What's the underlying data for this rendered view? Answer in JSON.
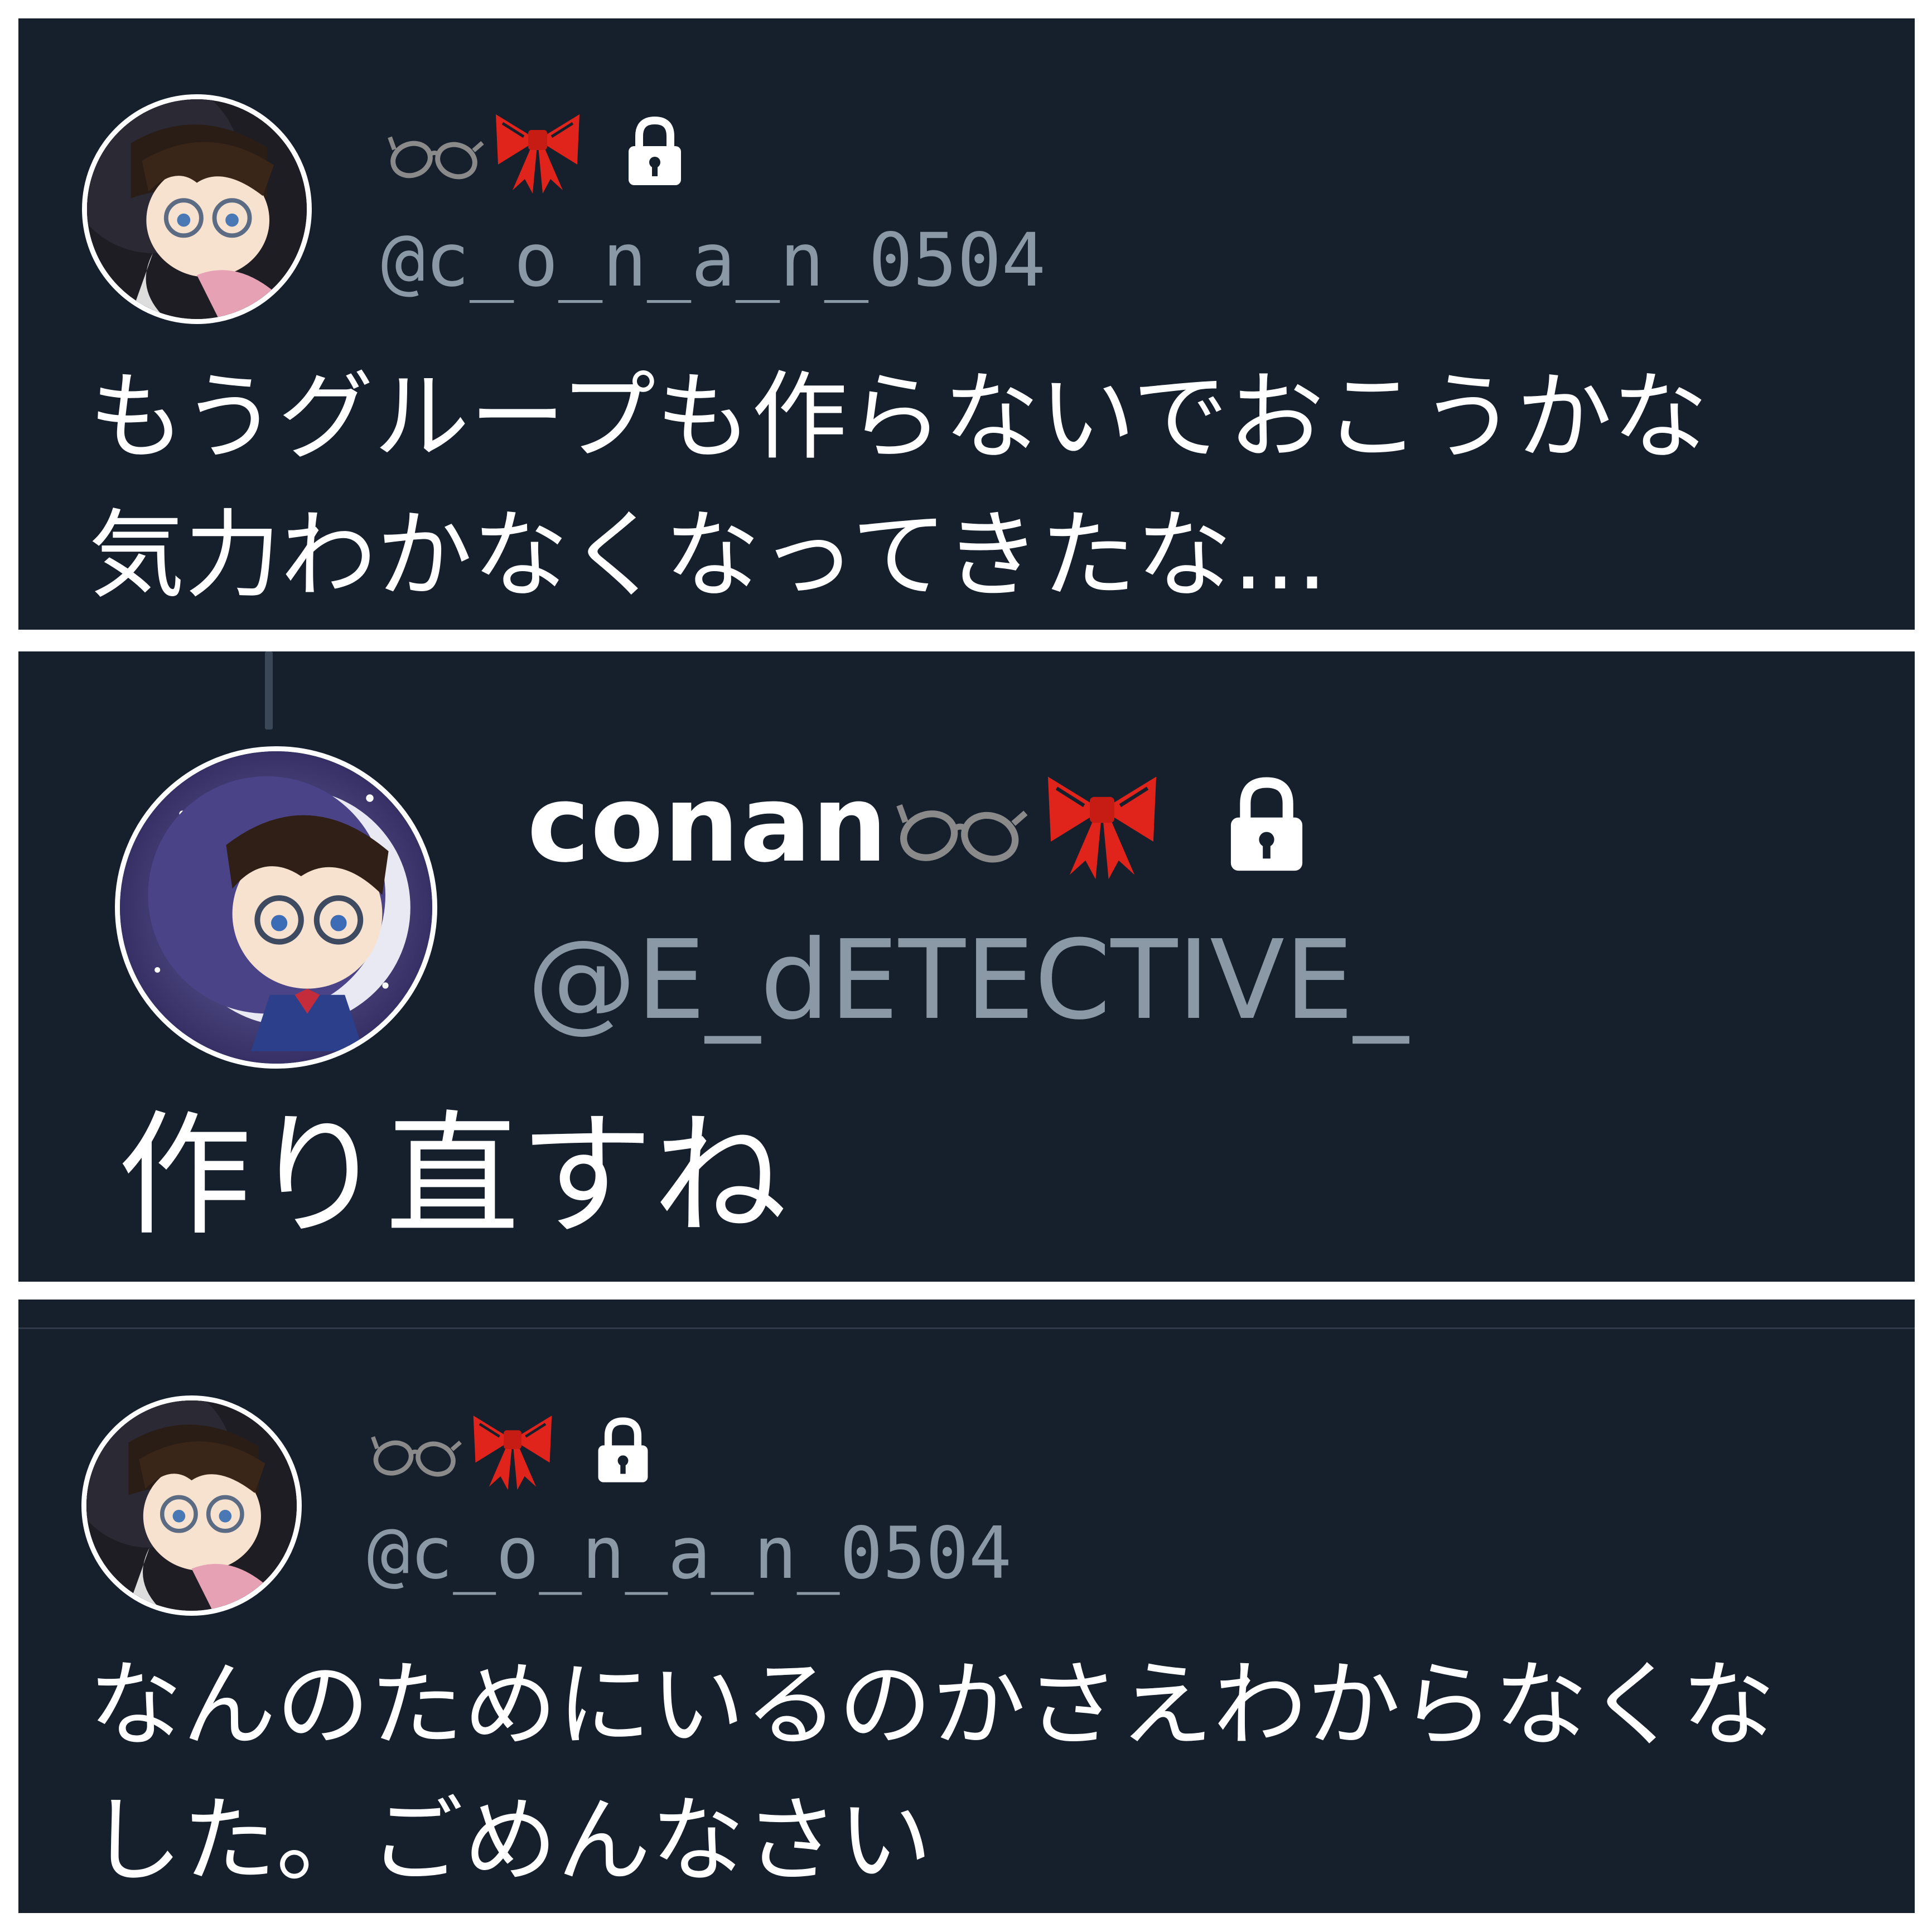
{
  "colors": {
    "panel_background": "#16202c",
    "handle": "#8b98a5",
    "text": "#ffffff",
    "bow": "#e0241b",
    "glasses": "#8a8a8a"
  },
  "tweets": [
    {
      "display_name": "",
      "icons": [
        "glasses-icon",
        "bow-icon",
        "lock-icon"
      ],
      "handle": "@c_o_n_a_n_0504",
      "text_lines": [
        "もうグループも作らないでおこうかな",
        "気力わかなくなってきたな…"
      ]
    },
    {
      "display_name": "conan",
      "icons": [
        "glasses-icon",
        "bow-icon",
        "lock-icon"
      ],
      "handle": "@E_dETECTIVE_",
      "text_lines": [
        "作り直すね"
      ]
    },
    {
      "display_name": "",
      "icons": [
        "glasses-icon",
        "bow-icon",
        "lock-icon"
      ],
      "handle": "@c_o_n_a_n_0504",
      "text_lines": [
        "なんのためにいるのかさえわからなくな",
        "した。ごめんなさい"
      ]
    }
  ]
}
